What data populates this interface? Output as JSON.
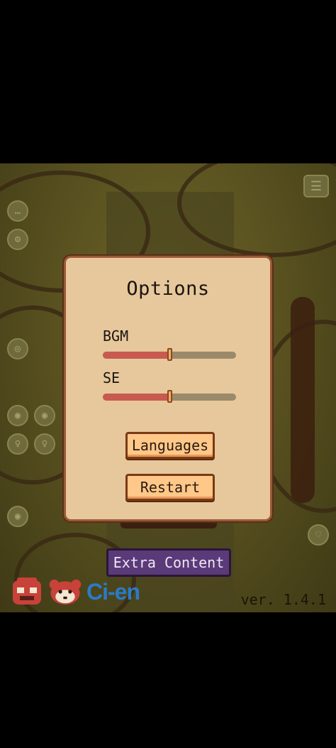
{
  "options": {
    "title": "Options",
    "bgm": {
      "label": "BGM",
      "value": 0.5
    },
    "se": {
      "label": "SE",
      "value": 0.5
    },
    "languages_label": "Languages",
    "restart_label": "Restart"
  },
  "extra_content_label": "Extra Content",
  "logo_text": "Ci-en",
  "version": "ver. 1.4.1",
  "colors": {
    "panel": "#e6c89c",
    "button": "#ffc788",
    "slider_fill": "#c85a50",
    "extra_button": "#5a3a78",
    "logo": "#2a7bc8"
  },
  "icons": [
    "menu-icon",
    "chat-icon",
    "settings-icon",
    "eye-icon",
    "bulb-icon",
    "heart-icon"
  ]
}
